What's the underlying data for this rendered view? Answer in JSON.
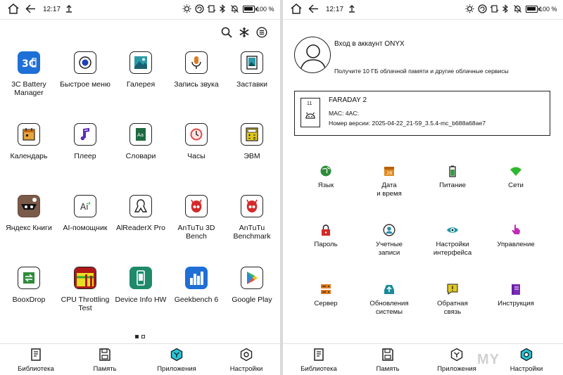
{
  "status": {
    "time": "12:17",
    "battery": "100 %"
  },
  "apps": [
    {
      "name": "3C Battery\nManager",
      "icon": "battery-manager-icon"
    },
    {
      "name": "Быстрое меню",
      "icon": "quick-menu-icon"
    },
    {
      "name": "Галерея",
      "icon": "gallery-icon"
    },
    {
      "name": "Запись звука",
      "icon": "microphone-icon"
    },
    {
      "name": "Заставки",
      "icon": "screensaver-icon"
    },
    {
      "name": "Календарь",
      "icon": "calendar-icon"
    },
    {
      "name": "Плеер",
      "icon": "music-note-icon"
    },
    {
      "name": "Словари",
      "icon": "dictionary-icon"
    },
    {
      "name": "Часы",
      "icon": "clock-icon"
    },
    {
      "name": "ЭВМ",
      "icon": "calculator-icon"
    },
    {
      "name": "Яндекс Книги",
      "icon": "yandex-books-icon"
    },
    {
      "name": "AI-помощник",
      "icon": "ai-assistant-icon"
    },
    {
      "name": "AlReaderX Pro",
      "icon": "alreader-icon"
    },
    {
      "name": "AnTuTu 3D\nBench",
      "icon": "antutu-3d-icon"
    },
    {
      "name": "AnTuTu\nBenchmark",
      "icon": "antutu-icon"
    },
    {
      "name": "BooxDrop",
      "icon": "booxdrop-icon"
    },
    {
      "name": "CPU Throttling\nTest",
      "icon": "cpu-throttling-icon"
    },
    {
      "name": "Device Info HW",
      "icon": "device-info-icon"
    },
    {
      "name": "Geekbench 6",
      "icon": "geekbench-icon"
    },
    {
      "name": "Google Play",
      "icon": "google-play-icon"
    }
  ],
  "page_indicator": {
    "current": 1,
    "total": 2
  },
  "nav": [
    {
      "label": "Библиотека",
      "icon": "library-icon"
    },
    {
      "label": "Память",
      "icon": "storage-icon"
    },
    {
      "label": "Приложения",
      "icon": "apps-icon"
    },
    {
      "label": "Настройки",
      "icon": "settings-icon"
    }
  ],
  "left_active_tab": "Приложения",
  "right_active_tab": "Настройки",
  "account": {
    "title": "Вход в аккаунт ONYX",
    "subtitle": "Получите 10 ГБ облачной памяти и другие облачные сервисы"
  },
  "device": {
    "name": "FARADAY 2",
    "mac": "MAC: 4AC:",
    "version": "Номер версии: 2025-04-22_21-59_3.5.4-mc_b688a68ae7",
    "screen_number": "11"
  },
  "settings": [
    {
      "label": "Язык",
      "icon": "globe-icon",
      "color": "#2e8b3a"
    },
    {
      "label": "Дата\nи время",
      "icon": "calendar-date-icon",
      "color": "#e08a1e"
    },
    {
      "label": "Питание",
      "icon": "battery-icon",
      "color": "#2e9a3a"
    },
    {
      "label": "Сети",
      "icon": "wifi-icon",
      "color": "#2eb82e"
    },
    {
      "label": "Пароль",
      "icon": "lock-icon",
      "color": "#d42a2a"
    },
    {
      "label": "Учетные\nзаписи",
      "icon": "account-icon",
      "color": "#2a8fa8"
    },
    {
      "label": "Настройки\nинтерфейса",
      "icon": "eye-icon",
      "color": "#1a9aa8"
    },
    {
      "label": "Управление",
      "icon": "touch-icon",
      "color": "#c02ab8"
    },
    {
      "label": "Сервер",
      "icon": "server-icon",
      "color": "#e07a1e"
    },
    {
      "label": "Обновления\nсистемы",
      "icon": "system-update-icon",
      "color": "#1a8a9a"
    },
    {
      "label": "Обратная\nсвязь",
      "icon": "feedback-icon",
      "color": "#e0c81e"
    },
    {
      "label": "Инструкция",
      "icon": "manual-icon",
      "color": "#7a2ab8"
    }
  ],
  "watermark": "MY"
}
